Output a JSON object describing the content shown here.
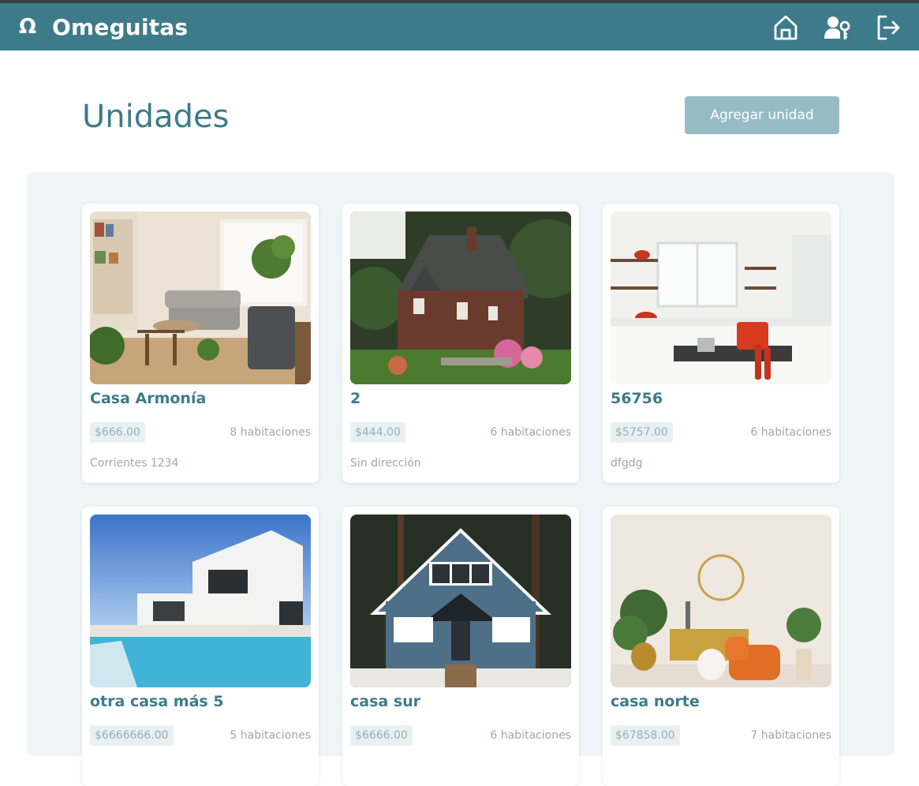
{
  "app": {
    "brand_icon": "Ω",
    "brand_name": "Omeguitas",
    "nav_icons": [
      "home-icon",
      "user-key-icon",
      "logout-icon"
    ],
    "colors": {
      "primary": "#3d7b8a",
      "button": "#96bcc3",
      "panel": "#eff4f6"
    }
  },
  "page": {
    "title": "Unidades",
    "add_button": "Agregar unidad"
  },
  "units": [
    {
      "name": "Casa Armonía",
      "price": "$666.00",
      "rooms": "8 habitaciones",
      "address": "Corrientes 1234",
      "image": "living-room"
    },
    {
      "name": "2",
      "price": "$444.00",
      "rooms": "6 habitaciones",
      "address": "Sin dirección",
      "image": "brick-cottage"
    },
    {
      "name": "56756",
      "price": "$5757.00",
      "rooms": "6 habitaciones",
      "address": "dfgdg",
      "image": "white-kitchen"
    },
    {
      "name": "otra casa más 5",
      "price": "$6666666.00",
      "rooms": "5 habitaciones",
      "address": "",
      "image": "modern-villa-pool"
    },
    {
      "name": "casa sur",
      "price": "$6666.00",
      "rooms": "6 habitaciones",
      "address": "",
      "image": "blue-cabin"
    },
    {
      "name": "casa norte",
      "price": "$67858.00",
      "rooms": "7 habitaciones",
      "address": "",
      "image": "orange-armchair-room"
    }
  ]
}
